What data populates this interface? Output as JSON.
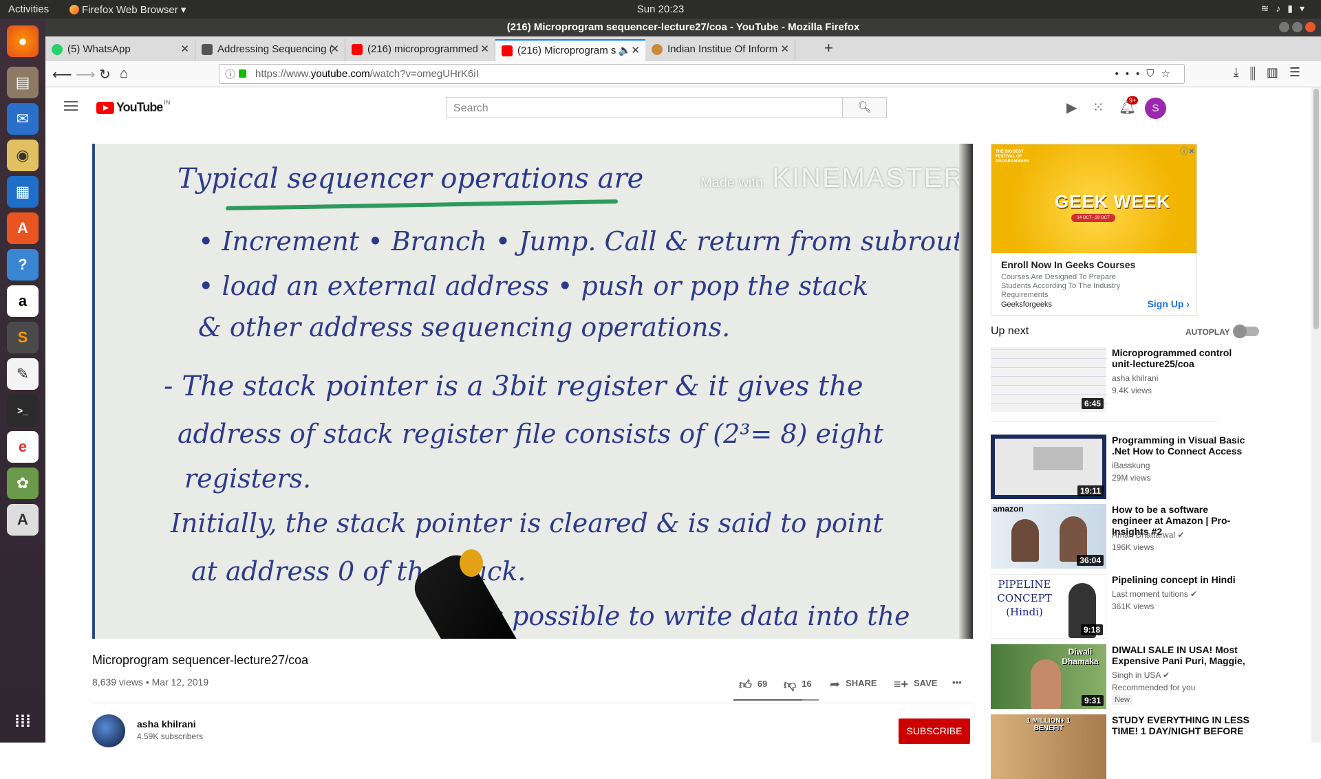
{
  "system_bar": {
    "activities": "Activities",
    "app_menu": "Firefox Web Browser ▾",
    "clock": "Sun 20:23"
  },
  "window": {
    "title": "(216) Microprogram sequencer-lecture27/coa - YouTube - Mozilla Firefox"
  },
  "tabs": [
    {
      "label": "(5) WhatsApp",
      "color": "#25d366"
    },
    {
      "label": "Addressing Sequencing (",
      "color": "#555555"
    },
    {
      "label": "(216) microprogrammed",
      "color": "#ff0000"
    },
    {
      "label": "(216) Microprogram s",
      "color": "#ff0000"
    },
    {
      "label": "Indian Institue Of Inform",
      "color": "#c98a3a"
    }
  ],
  "url": {
    "prefix": "https://www.",
    "host": "youtube.com",
    "path": "/watch?v=omegUHrK6iI"
  },
  "youtube": {
    "logo": "YouTube",
    "region": "IN",
    "search_placeholder": "Search",
    "notifications": "9+",
    "avatar_letter": "S"
  },
  "video": {
    "board_lines": [
      "Typical sequencer operations are",
      "• Increment   • Branch   • Jump.  Call & return from subroutine",
      "• load an external address   • push or pop the stack",
      "  & other address sequencing operations.",
      "- The stack pointer is a 3bit register & it gives the",
      "  address of stack register file consists of (2³= 8) eight",
      "  registers.",
      "Initially, the stack pointer is cleared & is said to point",
      "  at address 0 of the stack.",
      "  It is possible to write data into the"
    ],
    "watermark_small": "Made with",
    "watermark": "KINEMASTER",
    "title": "Microprogram sequencer-lecture27/coa",
    "meta": "8,639 views • Mar 12, 2019",
    "likes": "69",
    "dislikes": "16",
    "like_ratio": 0.81,
    "share": "SHARE",
    "save": "SAVE",
    "more": "•••"
  },
  "channel": {
    "name": "asha khilrani",
    "subs": "4.59K subscribers",
    "subscribe": "SUBSCRIBE"
  },
  "ad": {
    "festival": "THE BIGGEST FESTIVAL OF PROGRAMMERS",
    "brand": "GEEK WEEK",
    "dates": "14 OCT - 28 OCT",
    "headline": "Enroll Now In Geeks Courses",
    "body": "Courses Are Designed To Prepare Students According To The Industry Requirements",
    "source": "Geeksforgeeks",
    "cta": "Sign Up ›"
  },
  "sidebar": {
    "up_next": "Up next",
    "autoplay": "AUTOPLAY",
    "items": [
      {
        "title": "Microprogrammed control unit-lecture25/coa",
        "channel": "asha khilrani",
        "views": "9.4K views",
        "duration": "6:45"
      },
      {
        "title": "Programming in Visual Basic .Net How to Connect Access",
        "channel": "iBasskung",
        "views": "29M views",
        "duration": "19:11"
      },
      {
        "title": "How to be a software engineer at Amazon | Pro-Insights #2",
        "channel": "Aman Dhattarwal ✔",
        "views": "196K views",
        "duration": "36:04",
        "thumb_text": "amazon"
      },
      {
        "title": "Pipelining concept in Hindi",
        "channel": "Last moment tuitions ✔",
        "views": "361K views",
        "duration": "9:18",
        "thumb_text": "PIPELINE CONCEPT (Hindi)"
      },
      {
        "title": "DIWALI SALE IN USA! Most Expensive Pani Puri, Maggie,",
        "channel": "Singh in USA ✔",
        "views": "Recommended for you",
        "duration": "9:31",
        "badge": "New",
        "thumb_text": "Diwali Dhamaka"
      },
      {
        "title": "STUDY EVERYTHING IN LESS TIME! 1 DAY/NIGHT BEFORE",
        "channel": "",
        "views": "",
        "duration": "",
        "thumb_text": "1 MILLION+ 1 BENEFIT"
      }
    ]
  }
}
